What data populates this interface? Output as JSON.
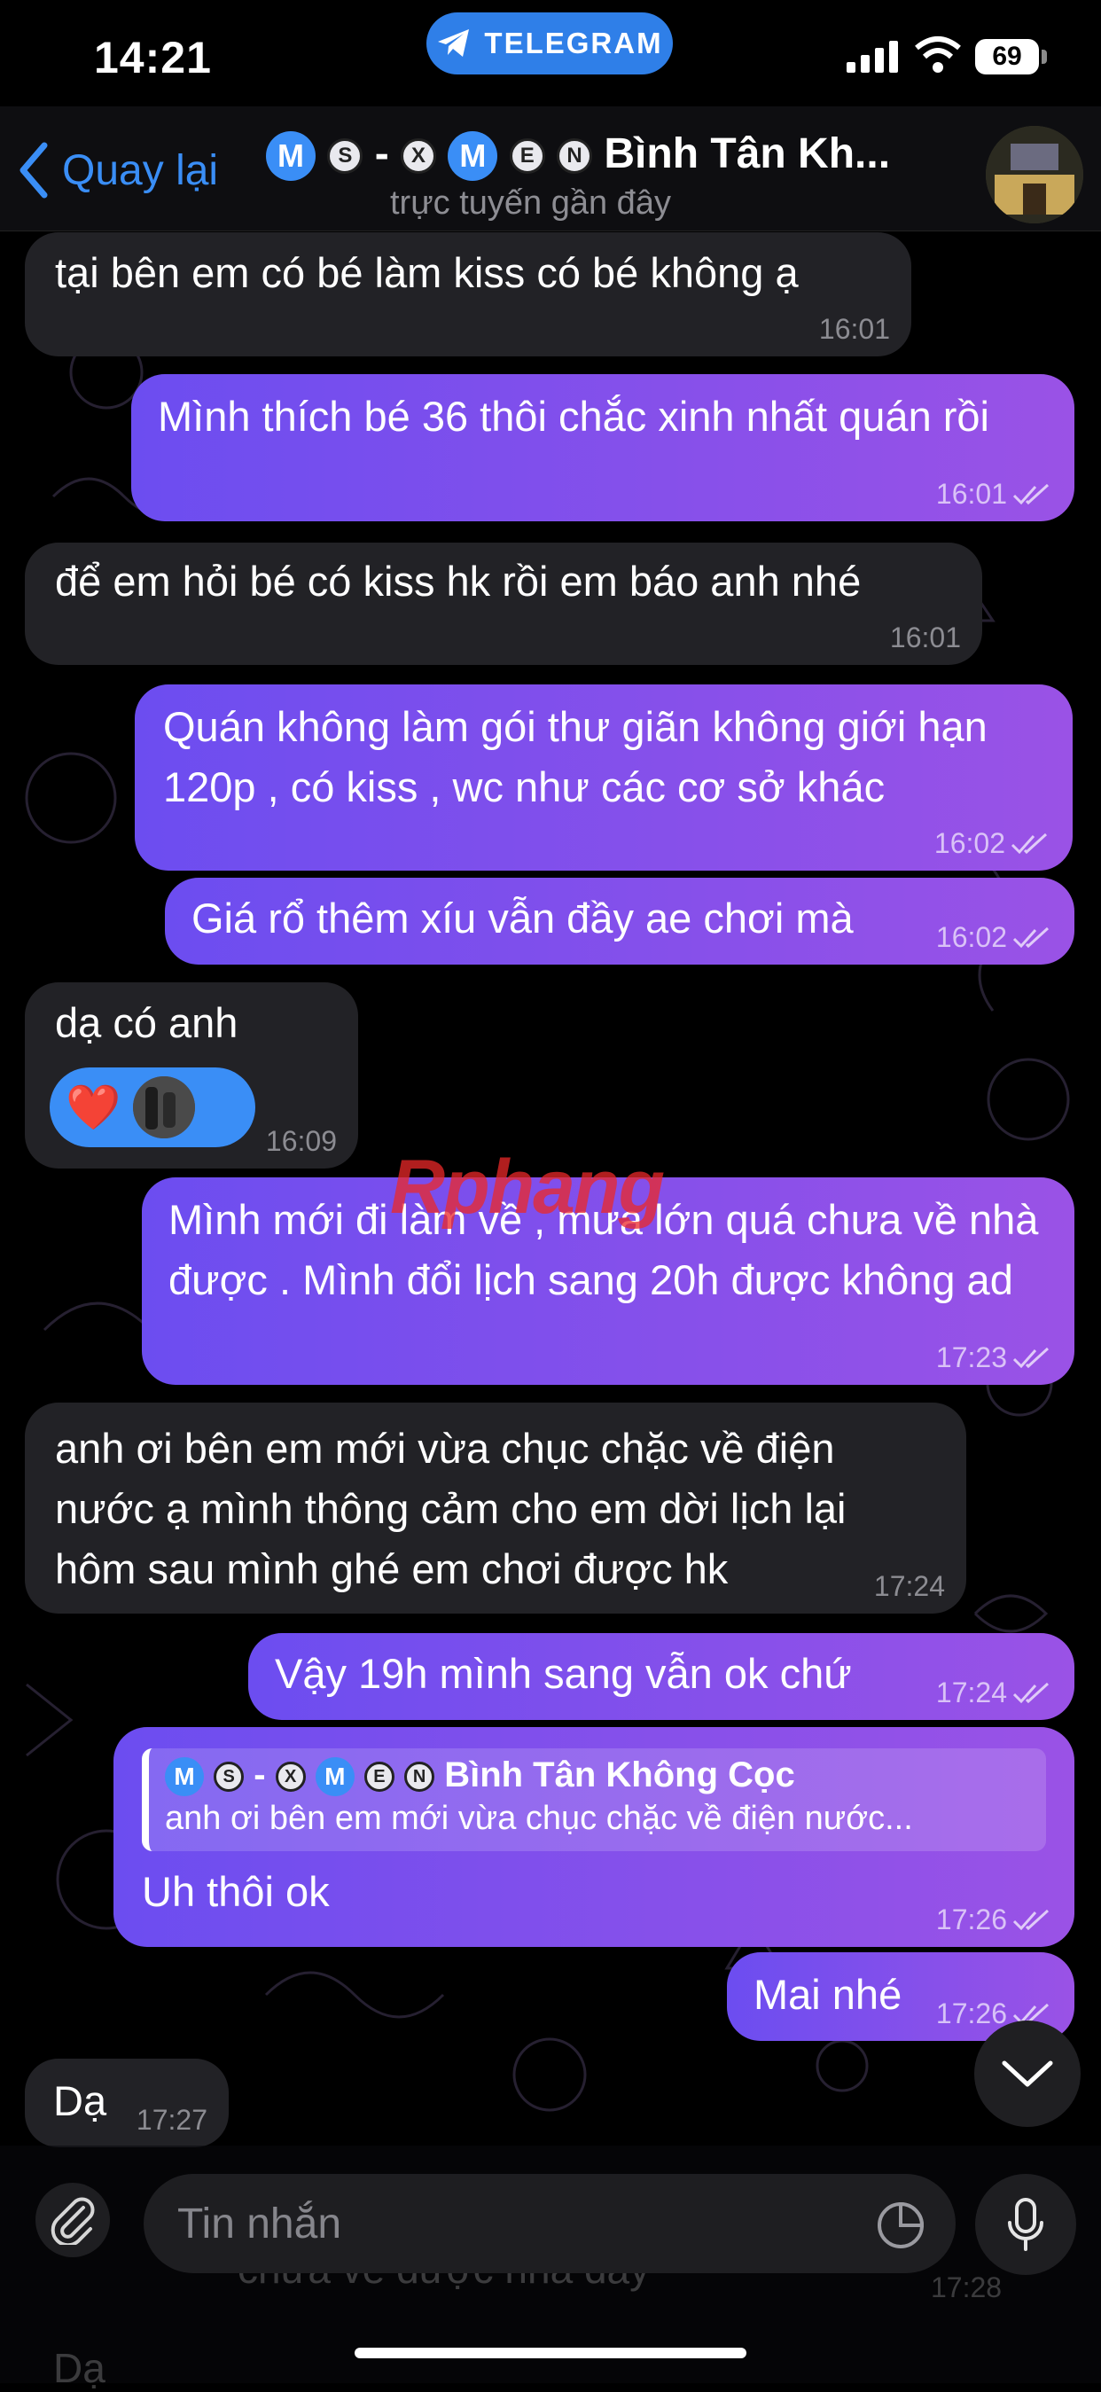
{
  "status_bar": {
    "time": "14:21",
    "app_pill": "TELEGRAM",
    "battery": "69"
  },
  "header": {
    "back_label": "Quay lại",
    "title_text": "Bình Tân Kh...",
    "subtitle": "trực tuyến gần đây"
  },
  "title_badges": [
    "M",
    "S",
    "X",
    "M",
    "E",
    "N"
  ],
  "messages": [
    {
      "direction": "in",
      "text": "tại bên em có bé làm kiss có bé không ạ",
      "time": "16:01"
    },
    {
      "direction": "out",
      "text": "Mình thích bé 36 thôi chắc xinh nhất quán rồi",
      "time": "16:01"
    },
    {
      "direction": "in",
      "text": "để em hỏi bé có kiss hk rồi em báo anh nhé",
      "time": "16:01"
    },
    {
      "direction": "out",
      "text": "Quán không làm gói thư giãn không giới hạn 120p , có kiss , wc như các cơ sở khác",
      "time": "16:02"
    },
    {
      "direction": "out",
      "text": "Giá rổ thêm xíu vẫn đầy ae chơi mà",
      "time": "16:02"
    },
    {
      "direction": "in",
      "text": "dạ có anh",
      "time": "16:09",
      "reaction": "❤️"
    },
    {
      "direction": "out",
      "text": "Mình mới đi làm về , mưa lớn quá  chưa về nhà được . Mình đổi lịch sang 20h được không ad",
      "time": "17:23"
    },
    {
      "direction": "in",
      "text": "anh ơi bên em mới vừa chục chặc về điện nước ạ mình thông cảm cho em dời lịch lại hôm sau mình ghé em chơi được hk",
      "time": "17:24"
    },
    {
      "direction": "out",
      "text": "Vậy 19h mình sang vẫn ok  chứ",
      "time": "17:24"
    },
    {
      "direction": "out",
      "text": "Uh thôi ok",
      "time": "17:26",
      "reply": {
        "author": "Bình Tân Không Cọc",
        "text": "anh ơi bên em mới vừa chục chặc về điện nước..."
      }
    },
    {
      "direction": "out",
      "text": "Mai nhé",
      "time": "17:26"
    },
    {
      "direction": "in",
      "text": "Dạ",
      "time": "17:27"
    }
  ],
  "watermark": "Rphang",
  "input": {
    "placeholder": "Tin nhắn"
  },
  "ghost": {
    "text": "chưa về được nhà đây",
    "time": "17:28",
    "last": "Dạ"
  },
  "colors": {
    "accent": "#3a8ef6",
    "outgoing_start": "#6c4df0",
    "outgoing_end": "#9a52e6",
    "incoming": "#222226"
  }
}
